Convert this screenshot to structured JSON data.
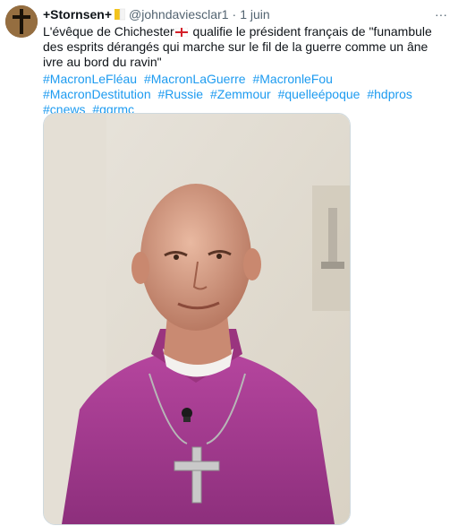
{
  "tweet": {
    "display_name": "+Stornsen+",
    "handle": "@johndaviesclar1",
    "separator": "·",
    "date": "1 juin",
    "text_part1": "L'évêque de Chichester",
    "text_part2": " qualifie le président français de \"funambule des esprits dérangés qui marche sur le fil de la guerre comme un âne ivre au bord du ravin\"",
    "hashtags": [
      "#MacronLeFléau",
      "#MacronLaGuerre",
      "#MacronleFou",
      "#MacronDestitution",
      "#Russie",
      "#Zemmour",
      "#quelleépoque",
      "#hdpros",
      "#cnews",
      "#ggrmc"
    ],
    "more_label": "···"
  },
  "icons": {
    "avatar": "cross-avatar-icon",
    "badge": "vatican-flag-icon",
    "flag": "england-flag-icon",
    "more": "more-icon"
  },
  "colors": {
    "link": "#1d9bf0",
    "secondary_text": "#536471",
    "cassock": "#a63a94"
  }
}
